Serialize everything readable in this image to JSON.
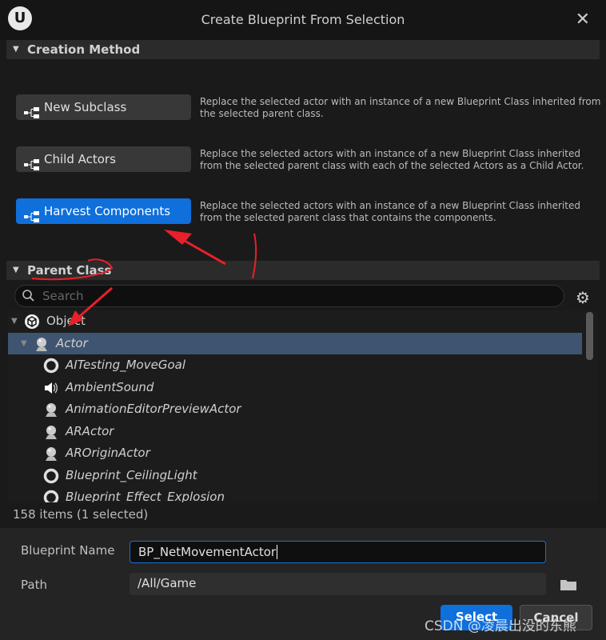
{
  "window": {
    "title": "Create Blueprint From Selection",
    "logo": "U"
  },
  "creation_method": {
    "header": "Creation Method",
    "options": [
      {
        "label": "New Subclass",
        "description": "Replace the selected actor with an instance of a new Blueprint Class inherited from the selected parent class.",
        "active": false
      },
      {
        "label": "Child Actors",
        "description": "Replace the selected actors with an instance of a new Blueprint Class inherited from the selected parent class with each of the selected Actors as a Child Actor.",
        "active": false
      },
      {
        "label": "Harvest Components",
        "description": "Replace the selected actors with an instance of a new Blueprint Class inherited from the selected parent class that contains the components.",
        "active": true
      }
    ]
  },
  "parent_class": {
    "header": "Parent Class",
    "search_placeholder": "Search",
    "tree": [
      {
        "label": "Object",
        "icon": "object-cube-icon",
        "indent": 0,
        "expanded": true
      },
      {
        "label": "Actor",
        "icon": "actor-icon",
        "indent": 1,
        "expanded": true,
        "selected": true
      },
      {
        "label": "AITesting_MoveGoal",
        "icon": "ring-icon",
        "indent": 2
      },
      {
        "label": "AmbientSound",
        "icon": "speaker-icon",
        "indent": 2
      },
      {
        "label": "AnimationEditorPreviewActor",
        "icon": "actor-icon",
        "indent": 2
      },
      {
        "label": "ARActor",
        "icon": "actor-icon",
        "indent": 2
      },
      {
        "label": "AROriginActor",
        "icon": "actor-icon",
        "indent": 2
      },
      {
        "label": "Blueprint_CeilingLight",
        "icon": "ring-icon",
        "indent": 2
      },
      {
        "label": "Blueprint_Effect_Explosion",
        "icon": "ring-icon",
        "indent": 2
      }
    ],
    "status": "158 items (1 selected)"
  },
  "form": {
    "name_label": "Blueprint Name",
    "name_value": "BP_NetMovementActor",
    "path_label": "Path",
    "path_value": "/All/Game"
  },
  "buttons": {
    "select": "Select",
    "cancel": "Cancel"
  },
  "colors": {
    "accent": "#0f6fdb",
    "selection": "#3f5470",
    "annotation": "#e8202a"
  },
  "watermark": "CSDN @凌晨出没的东熊"
}
